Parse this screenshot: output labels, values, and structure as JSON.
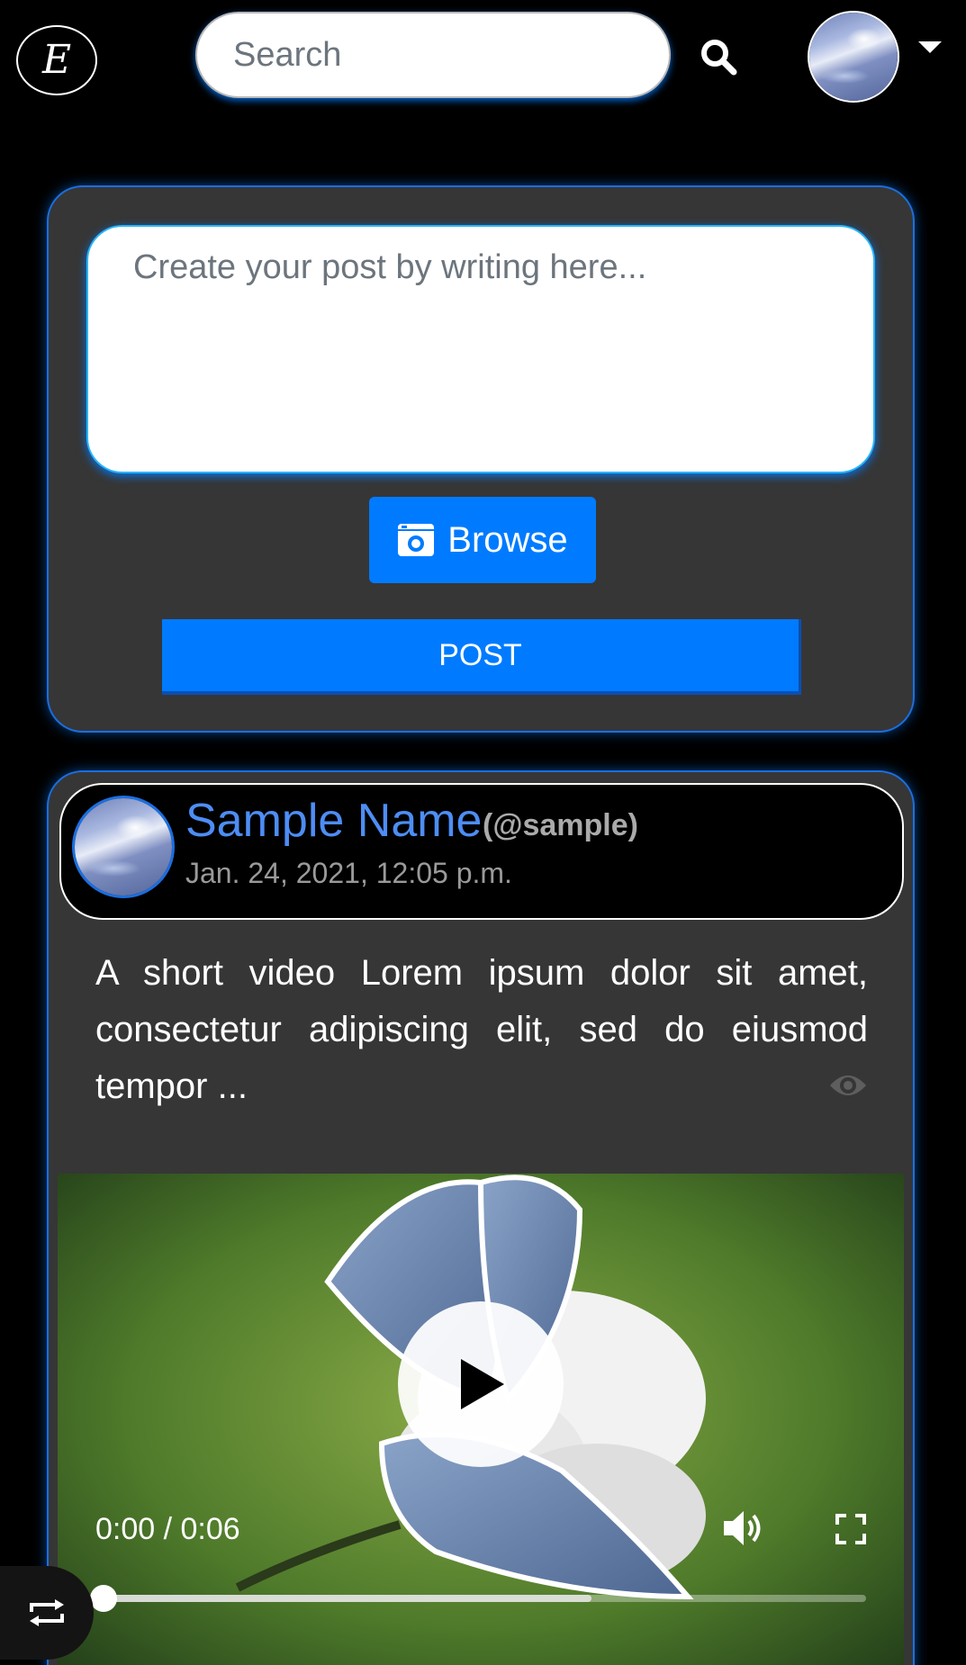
{
  "navbar": {
    "logo_text": "E",
    "search": {
      "placeholder": "Search",
      "value": ""
    },
    "icons": {
      "search": "search-icon",
      "profile_menu": "chevron-down-icon"
    }
  },
  "composer": {
    "placeholder": "Create your post by writing here...",
    "browse_label": "Browse",
    "post_label": "POST",
    "icons": {
      "browse": "camera-icon"
    }
  },
  "feed": {
    "posts": [
      {
        "author_name": "Sample Name",
        "author_handle": "(@sample)",
        "timestamp": "Jan. 24, 2021, 12:05 p.m.",
        "text": "A short video Lorem ipsum dolor sit amet, consectetur adipiscing elit, sed do eiusmod tempor ...",
        "video": {
          "time_display": "0:00 / 0:06",
          "progress": 0,
          "buffered": 0.64
        }
      }
    ]
  },
  "colors": {
    "accent": "#007bff",
    "card_bg": "#363636",
    "card_border": "#1b6fe0",
    "author_name": "#4d8df5",
    "page_bg": "#000000"
  },
  "fab": {
    "icon": "repost-icon"
  }
}
